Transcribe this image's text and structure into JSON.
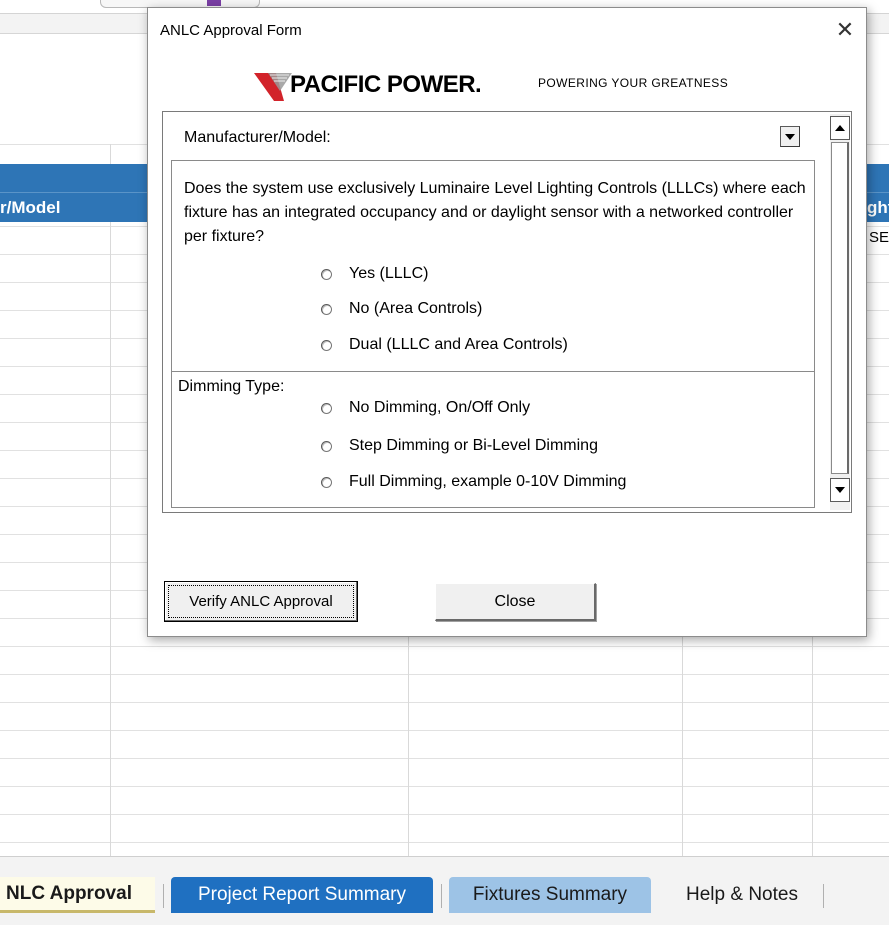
{
  "dialog": {
    "title": "ANLC Approval Form",
    "close_glyph": "✕"
  },
  "logo": {
    "brand": "PACIFIC POWER.",
    "tagline": "POWERING YOUR GREATNESS",
    "colors": {
      "red": "#d2232a",
      "grey": "#9a9a9a"
    }
  },
  "form": {
    "manufacturer_label": "Manufacturer/Model:",
    "manufacturer_value": "",
    "question": "Does the system use exclusively Luminaire Level Lighting Controls (LLLCs) where each fixture has an integrated occupancy and or daylight sensor with a networked controller per fixture?",
    "control_options": [
      {
        "label": "Yes (LLLC)"
      },
      {
        "label": "No (Area Controls)"
      },
      {
        "label": "Dual (LLLC and Area Controls)"
      }
    ],
    "dimming_label": "Dimming Type:",
    "dimming_options": [
      {
        "label": "No Dimming, On/Off Only"
      },
      {
        "label": "Step Dimming or Bi-Level Dimming"
      },
      {
        "label": "Full Dimming, example 0-10V Dimming"
      }
    ]
  },
  "buttons": {
    "verify": "Verify ANLC Approval",
    "close": "Close"
  },
  "sheet": {
    "header_left": "r/Model",
    "header_right": "ght",
    "cell_right": "SE",
    "header_color": "#2e75b6"
  },
  "tabs": [
    {
      "label": "NLC Approval"
    },
    {
      "label": "Project Report Summary"
    },
    {
      "label": "Fixtures Summary"
    },
    {
      "label": "Help & Notes"
    }
  ]
}
